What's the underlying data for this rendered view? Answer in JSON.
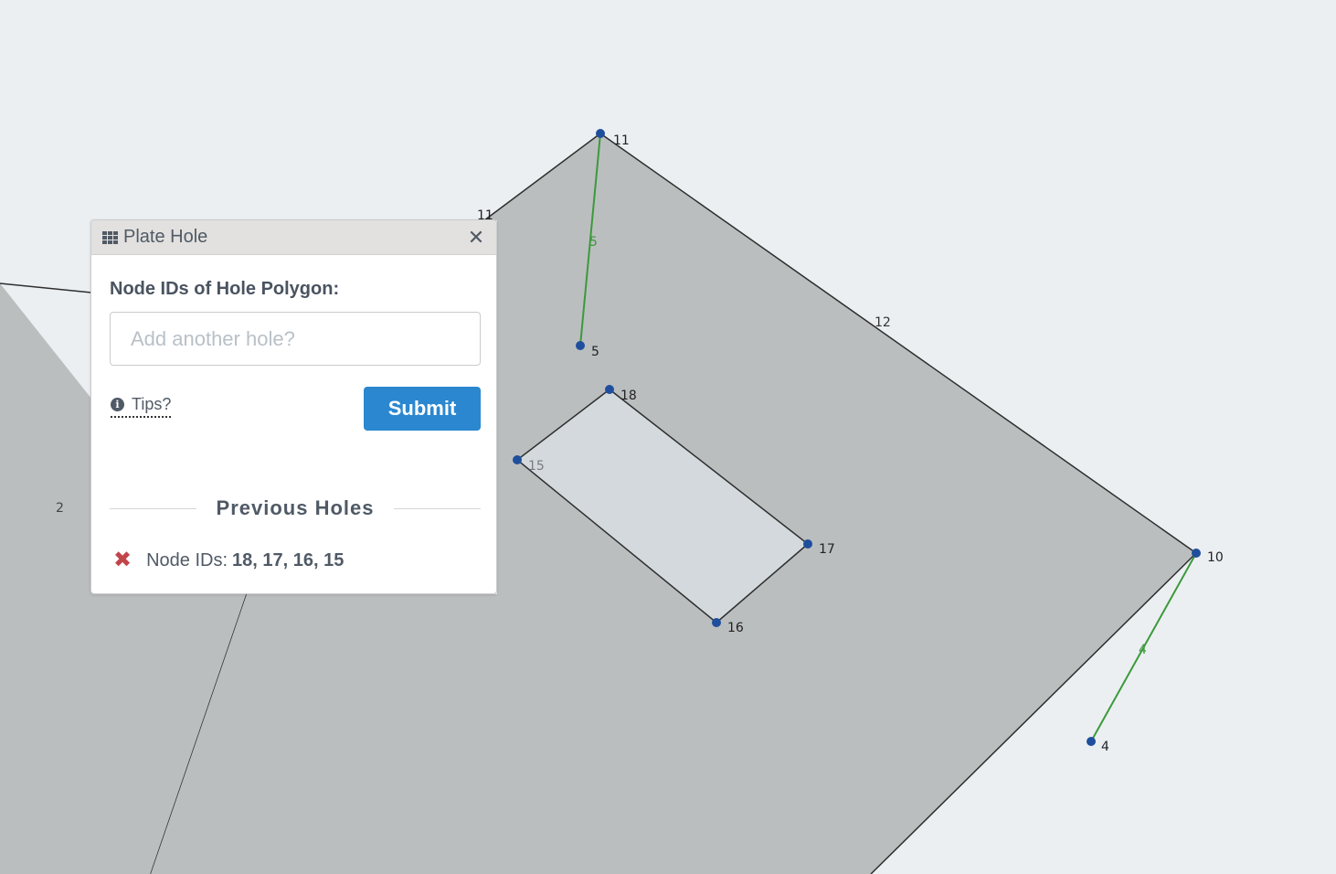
{
  "canvas": {
    "face_fill": "#bbbebf",
    "hole_fill": "#d3d9dc",
    "edge_color": "#2e2e2e",
    "support_color": "#3b9a3b",
    "node_color": "#1f4f9c",
    "node_labels": {
      "n11": "11",
      "n5": "5",
      "n18": "18",
      "n15": "15",
      "n17": "17",
      "n16": "16",
      "n10": "10",
      "n4": "4"
    },
    "edge_labels": {
      "e11": "11",
      "e5": "5",
      "e12": "12",
      "e2": "2",
      "e4": "4"
    }
  },
  "panel": {
    "title": "Plate Hole",
    "title_icon": "grid-icon",
    "close_icon": "close-icon",
    "field_label": "Node IDs of Hole Polygon:",
    "input_placeholder": "Add another hole?",
    "input_value": "",
    "tips_label": "Tips?",
    "submit_label": "Submit",
    "previous_heading": "Previous Holes",
    "previous_holes": [
      {
        "prefix": "Node IDs:",
        "ids": "18, 17, 16, 15"
      }
    ],
    "accent_color": "#2a87d0",
    "delete_color": "#c0454a"
  }
}
